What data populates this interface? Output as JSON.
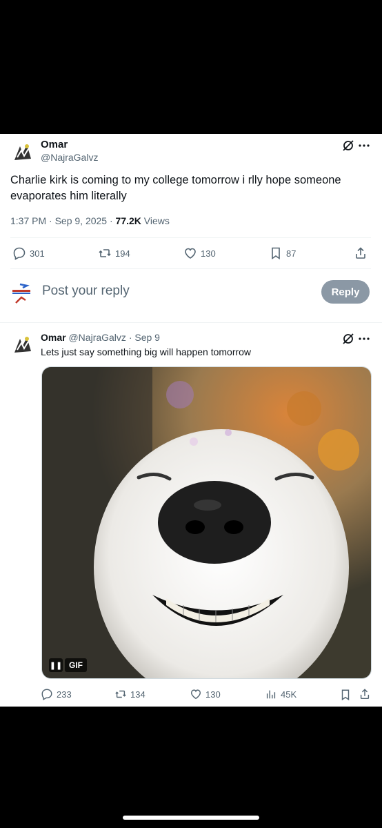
{
  "main_tweet": {
    "name": "Omar",
    "handle": "@NajraGalvz",
    "text": "Charlie kirk is coming to my college tomorrow i rlly hope someone evaporates him literally",
    "time": "1:37 PM · Sep 9, 2025 · ",
    "views_count": "77.2K",
    "views_label": " Views",
    "replies": "301",
    "reposts": "194",
    "likes": "130",
    "bookmarks": "87"
  },
  "reply_bar": {
    "placeholder": "Post your reply",
    "button": "Reply"
  },
  "second_tweet": {
    "name": "Omar",
    "handle": "@NajraGalvz",
    "date": "· Sep 9",
    "text": "Lets just say something big will happen tomorrow",
    "gif_label": "GIF",
    "replies": "233",
    "reposts": "134",
    "likes": "130",
    "views": "45K"
  },
  "colors": {
    "text": "#0f1419",
    "muted": "#536471",
    "reply_button": "#8b98a5"
  }
}
